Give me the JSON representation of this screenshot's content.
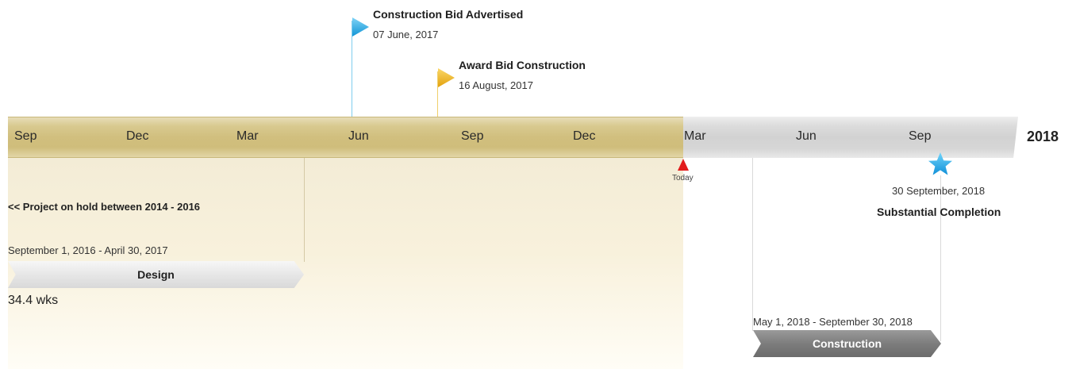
{
  "timeline": {
    "year_label": "2018",
    "months": [
      "Sep",
      "Dec",
      "Mar",
      "Jun",
      "Sep",
      "Dec",
      "Mar",
      "Jun",
      "Sep"
    ],
    "colors": {
      "past_band": "#d1bf7e",
      "future_band": "#d2d2d2",
      "today": "#e21c1c"
    }
  },
  "today": {
    "label": "Today"
  },
  "milestones": [
    {
      "title": "Construction Bid Advertised",
      "date": "07 June, 2017",
      "color": "#1fa7e0"
    },
    {
      "title": "Award Bid Construction",
      "date": "16 August, 2017",
      "color": "#f2b51c"
    },
    {
      "title": "Substantial Completion",
      "date": "30 September, 2018",
      "color": "#22aaee",
      "icon": "star-icon"
    }
  ],
  "notes": {
    "hold": "<< Project on hold between 2014 - 2016"
  },
  "tasks": [
    {
      "name": "Design",
      "range": "September 1, 2016 - April 30, 2017",
      "duration": "34.4 wks"
    },
    {
      "name": "Construction",
      "range": "May 1, 2018 - September 30, 2018"
    }
  ]
}
